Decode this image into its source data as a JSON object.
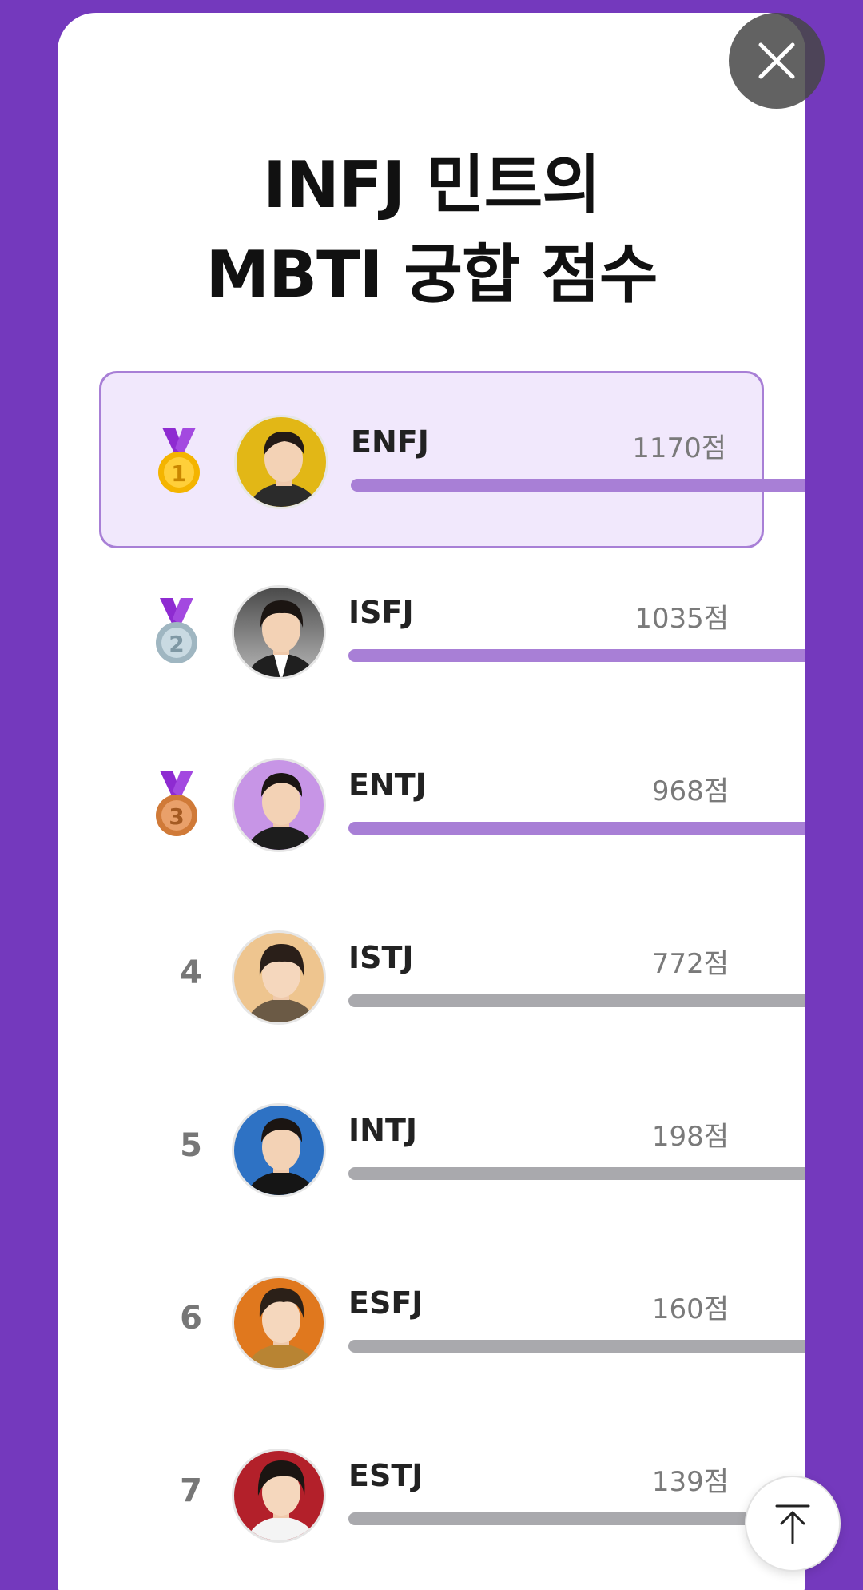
{
  "title": {
    "line1": "INFJ 민트의",
    "line2": "MBTI 궁합 점수"
  },
  "colors": {
    "background": "#7439bd",
    "highlight": "#f1e8fc",
    "bar_top3": "#a87fd6",
    "bar_rest": "#a9a9ad",
    "gold": "#f4b400",
    "silver": "#b9cdd6",
    "bronze": "#d98c4e"
  },
  "rankings": [
    {
      "rank": "1",
      "medal": "gold-medal",
      "type": "ENFJ",
      "score": "1170점",
      "avatar_bg": "#e2b716"
    },
    {
      "rank": "2",
      "medal": "silver-medal",
      "type": "ISFJ",
      "score": "1035점",
      "avatar_bg": "#5a5a5a"
    },
    {
      "rank": "3",
      "medal": "bronze-medal",
      "type": "ENTJ",
      "score": "968점",
      "avatar_bg": "#c795e6"
    },
    {
      "rank": "4",
      "medal": "",
      "type": "ISTJ",
      "score": "772점",
      "avatar_bg": "#eec58f"
    },
    {
      "rank": "5",
      "medal": "",
      "type": "INTJ",
      "score": "198점",
      "avatar_bg": "#2e72c4"
    },
    {
      "rank": "6",
      "medal": "",
      "type": "ESFJ",
      "score": "160점",
      "avatar_bg": "#e0781e"
    },
    {
      "rank": "7",
      "medal": "",
      "type": "ESTJ",
      "score": "139점",
      "avatar_bg": "#b3202a"
    }
  ],
  "icons": {
    "close": "close-icon",
    "scroll_top": "arrow-up-to-top-icon"
  }
}
